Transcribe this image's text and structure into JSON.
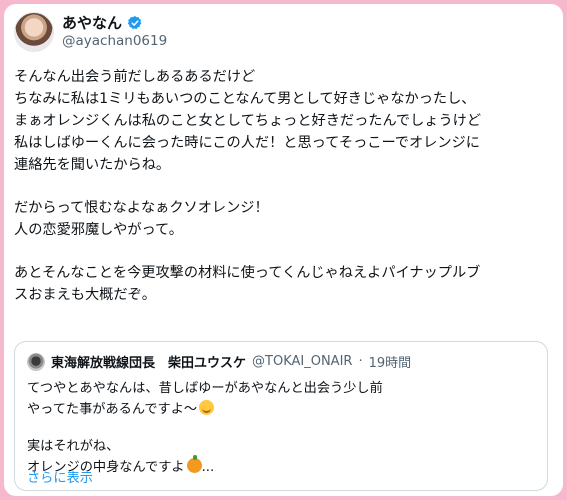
{
  "author": {
    "display_name": "あやなん",
    "handle": "@ayachan0619",
    "verified_icon": "verified-badge-icon",
    "badge_color": "#1d9bf0"
  },
  "tweet": {
    "paragraphs": [
      [
        "そんなん出会う前だしあるあるだけど",
        "ちなみに私は1ミリもあいつのことなんて男として好きじゃなかったし、",
        "まぁオレンジくんは私のこと女としてちょっと好きだったんでしょうけど",
        "私はしばゆーくんに会った時にこの人だ！と思ってそっこーでオレンジに",
        "連絡先を聞いたからね。"
      ],
      [
        "だからって恨むなよなぁクソオレンジ！",
        "人の恋愛邪魔しやがって。"
      ],
      [
        "あとそんなことを今更攻撃の材料に使ってくんじゃねえよパイナップルブ",
        "スおまえも大概だぞ。"
      ]
    ]
  },
  "quote": {
    "display_name": "東海解放戦線団長　柴田ユウスケ",
    "handle": "@TOKAI_ONAIR",
    "separator": "·",
    "time": "19時間",
    "lines": [
      "てつやとあやなんは、昔しばゆーがあやなんと出会う少し前",
      "やってた事があるんですよ〜",
      "実はそれがね、",
      "オレンジの中身なんですよ",
      "..."
    ],
    "emoji": [
      "smiling-face-emoji",
      "orange-emoji"
    ],
    "show_more": "さらに表示"
  },
  "colors": {
    "background_border": "#f5b8cc",
    "link": "#1d9bf0",
    "text": "#0f1419",
    "muted": "#536471"
  }
}
